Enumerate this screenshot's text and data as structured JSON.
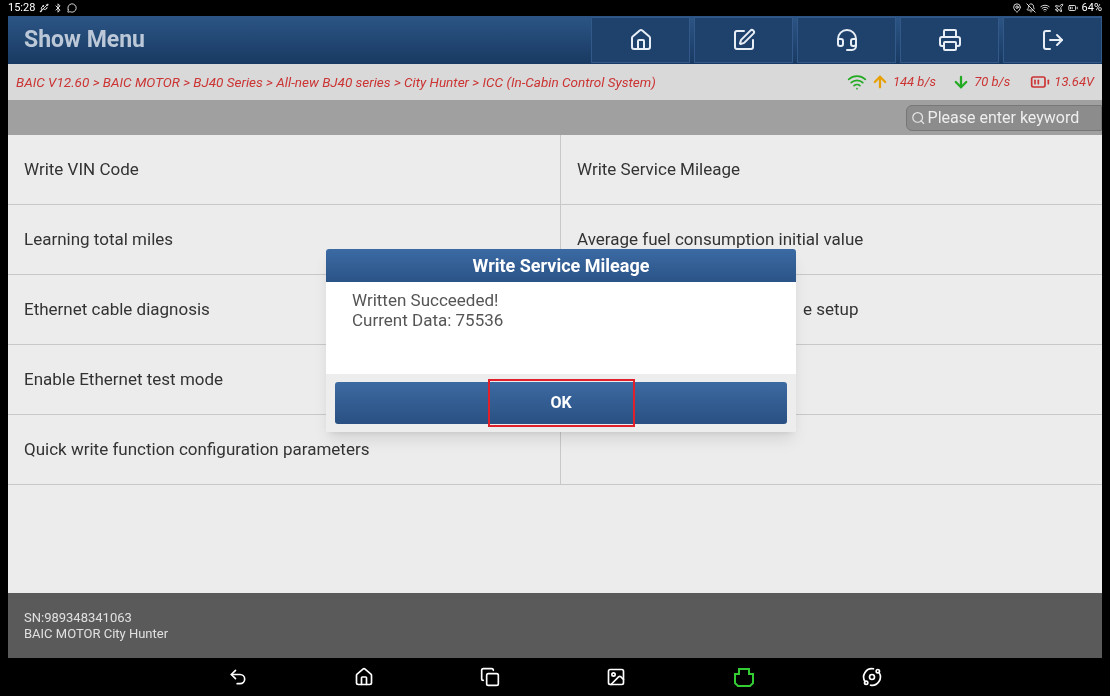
{
  "status_bar": {
    "time": "15:28",
    "battery": "64%"
  },
  "header": {
    "title": "Show Menu"
  },
  "breadcrumb": {
    "path": "BAIC V12.60 > BAIC MOTOR > BJ40 Series > All-new BJ40 series > City Hunter > ICC (In-Cabin Control System)",
    "upload": "144 b/s",
    "download": "70 b/s",
    "voltage": "13.64V"
  },
  "search": {
    "placeholder": "Please enter keyword"
  },
  "menu_rows": [
    {
      "left": {
        "label": "Write VIN Code"
      },
      "right": {
        "label": "Write Service Mileage"
      }
    },
    {
      "left": {
        "label": "Learning total miles"
      },
      "right": {
        "label": "Average fuel consumption initial value"
      }
    },
    {
      "left": {
        "label": "Ethernet cable diagnosis"
      },
      "right": {
        "label": "e setup",
        "kind": "fragment"
      }
    },
    {
      "left": {
        "label": "Enable Ethernet test mode"
      }
    },
    {
      "left": {
        "label": "Quick write function configuration parameters"
      }
    }
  ],
  "footer": {
    "serial": "SN:989348341063",
    "vehicle": "BAIC MOTOR City Hunter"
  },
  "dialog": {
    "title": "Write Service Mileage",
    "lines": [
      "Written Succeeded!",
      "Current Data: 75536"
    ],
    "button": "OK",
    "button_highlighted": true
  }
}
